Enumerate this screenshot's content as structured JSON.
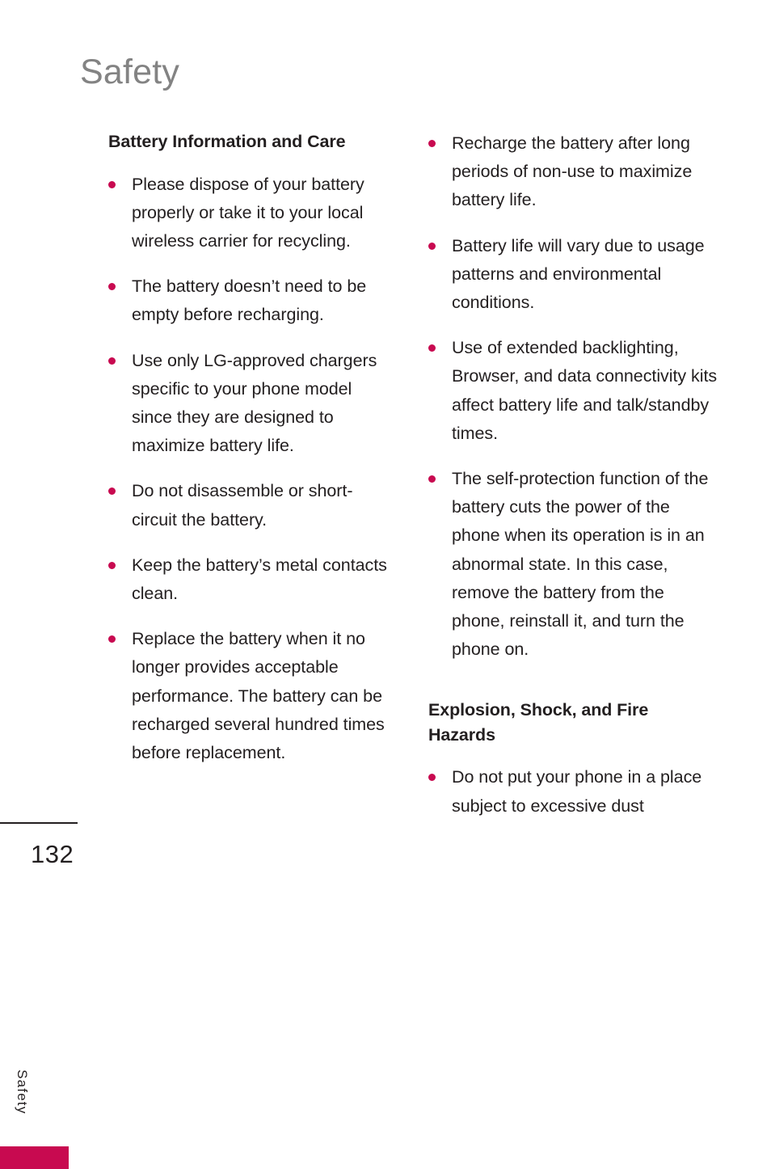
{
  "page": {
    "title": "Safety",
    "number": "132",
    "side_tab_label": "Safety",
    "accent_color": "#c80a50",
    "title_color": "#838383",
    "text_color": "#231f20"
  },
  "left_column": {
    "heading": "Battery Information and Care",
    "bullets": [
      "Please dispose of your battery properly or take it to your local wireless carrier for recycling.",
      "The battery doesn’t need to be empty before recharging.",
      "Use only LG-approved chargers specific to your phone model since they are designed to maximize battery life.",
      "Do not disassemble or short-circuit the battery.",
      "Keep the battery’s metal contacts clean.",
      "Replace the battery when it no longer provides acceptable performance. The battery can be recharged several hundred times before replacement."
    ]
  },
  "right_column": {
    "bullets_top": [
      "Recharge the battery after long periods of non-use to maximize battery life.",
      "Battery life will vary due to usage patterns and environmental conditions.",
      "Use of extended backlighting, Browser, and data connectivity kits affect battery life and talk/standby times.",
      "The self-protection function of the battery cuts the power of the phone when its operation is in an abnormal state. In this case, remove the battery from the phone, reinstall it, and turn the phone on."
    ],
    "heading": "Explosion, Shock, and Fire Hazards",
    "bullets_bottom": [
      "Do not put your phone in a place subject to excessive dust"
    ]
  }
}
